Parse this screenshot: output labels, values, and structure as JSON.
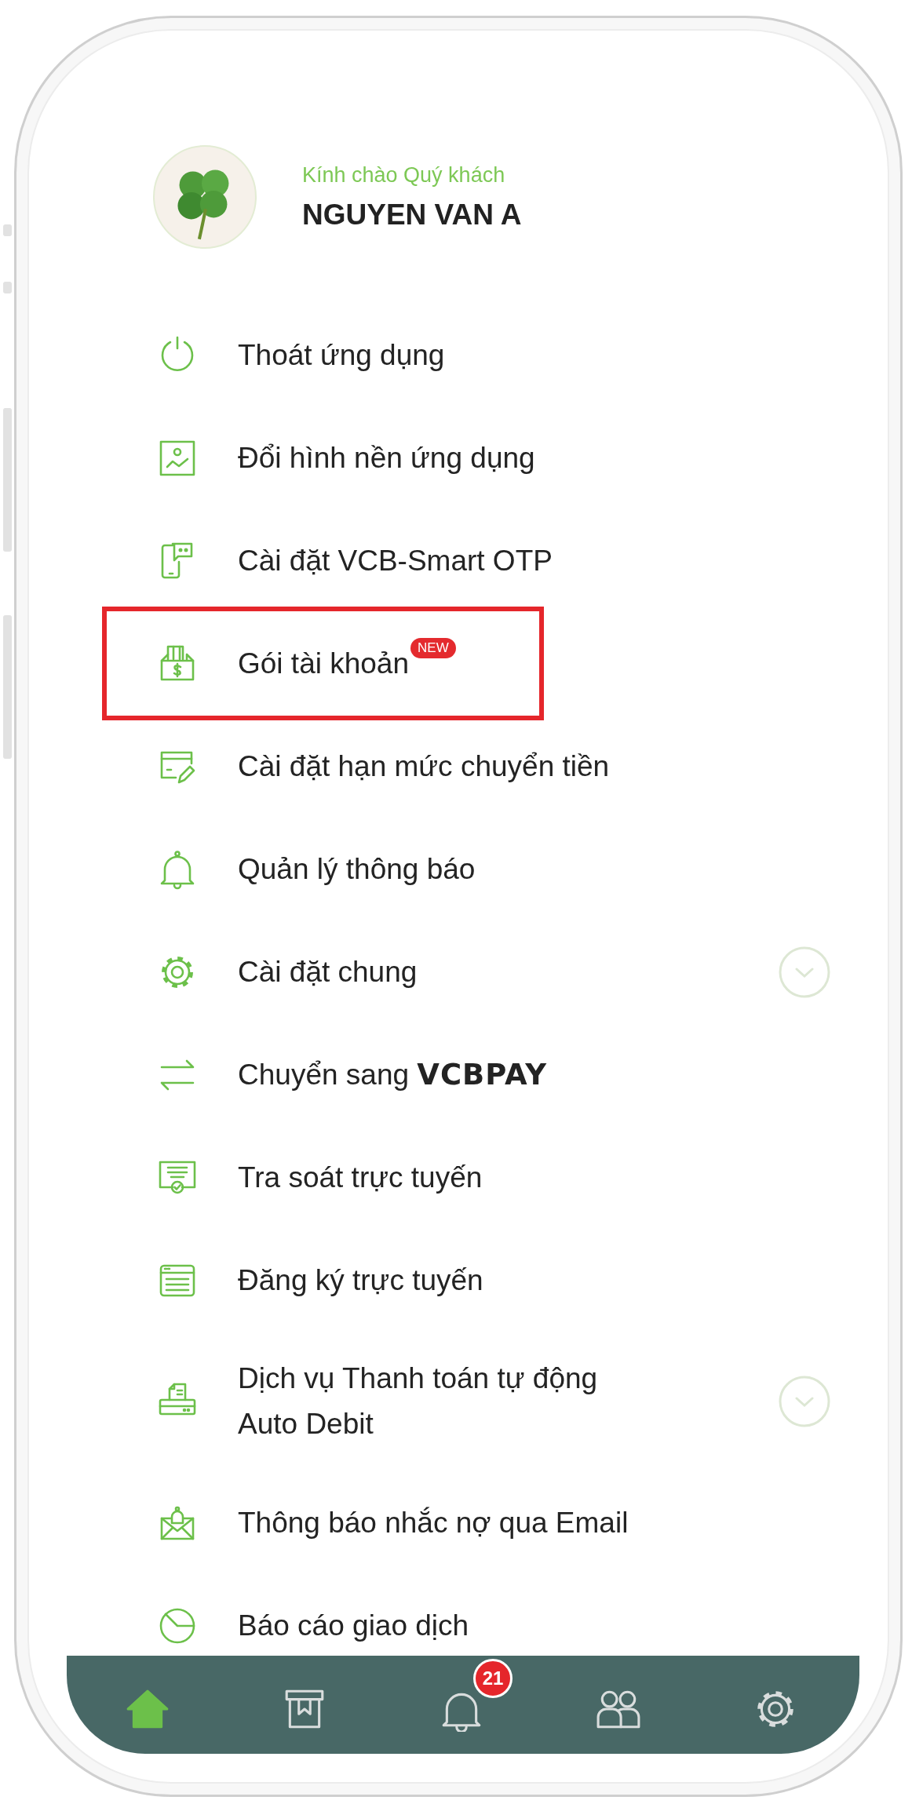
{
  "header": {
    "greeting": "Kính chào Quý khách",
    "name": "NGUYEN VAN A"
  },
  "menu": [
    {
      "kind": "power",
      "label": "Thoát ứng dụng",
      "expandable": false,
      "highlighted": false
    },
    {
      "kind": "image",
      "label": "Đổi hình nền ứng dụng",
      "expandable": false,
      "highlighted": false
    },
    {
      "kind": "otp",
      "label": "Cài đặt VCB-Smart OTP",
      "expandable": false,
      "highlighted": false
    },
    {
      "kind": "wallet",
      "label": "Gói tài khoản",
      "badge": "NEW",
      "expandable": false,
      "highlighted": true
    },
    {
      "kind": "limit",
      "label": "Cài đặt hạn mức chuyển tiền",
      "expandable": false,
      "highlighted": false
    },
    {
      "kind": "bell",
      "label": "Quản lý thông báo",
      "expandable": false,
      "highlighted": false
    },
    {
      "kind": "gear",
      "label": "Cài đặt chung",
      "expandable": true,
      "highlighted": false
    },
    {
      "kind": "swap",
      "label": "Chuyển sang **VCBPAY**",
      "expandable": false,
      "highlighted": false
    },
    {
      "kind": "certificate",
      "label": "Tra soát trực tuyến",
      "expandable": false,
      "highlighted": false
    },
    {
      "kind": "form",
      "label": "Đăng ký trực tuyến",
      "expandable": false,
      "highlighted": false
    },
    {
      "kind": "printer",
      "label": "Dịch vụ Thanh toán tự động\nAuto Debit",
      "expandable": true,
      "highlighted": false
    },
    {
      "kind": "mail",
      "label": "Thông báo nhắc nợ qua Email",
      "expandable": false,
      "highlighted": false
    },
    {
      "kind": "pie",
      "label": "Báo cáo giao dịch",
      "expandable": false,
      "highlighted": false
    }
  ],
  "nav": [
    {
      "kind": "home",
      "selected": true
    },
    {
      "kind": "box",
      "selected": false
    },
    {
      "kind": "bell",
      "selected": false,
      "badge": "21"
    },
    {
      "kind": "people",
      "selected": false
    },
    {
      "kind": "gear",
      "selected": false
    }
  ]
}
